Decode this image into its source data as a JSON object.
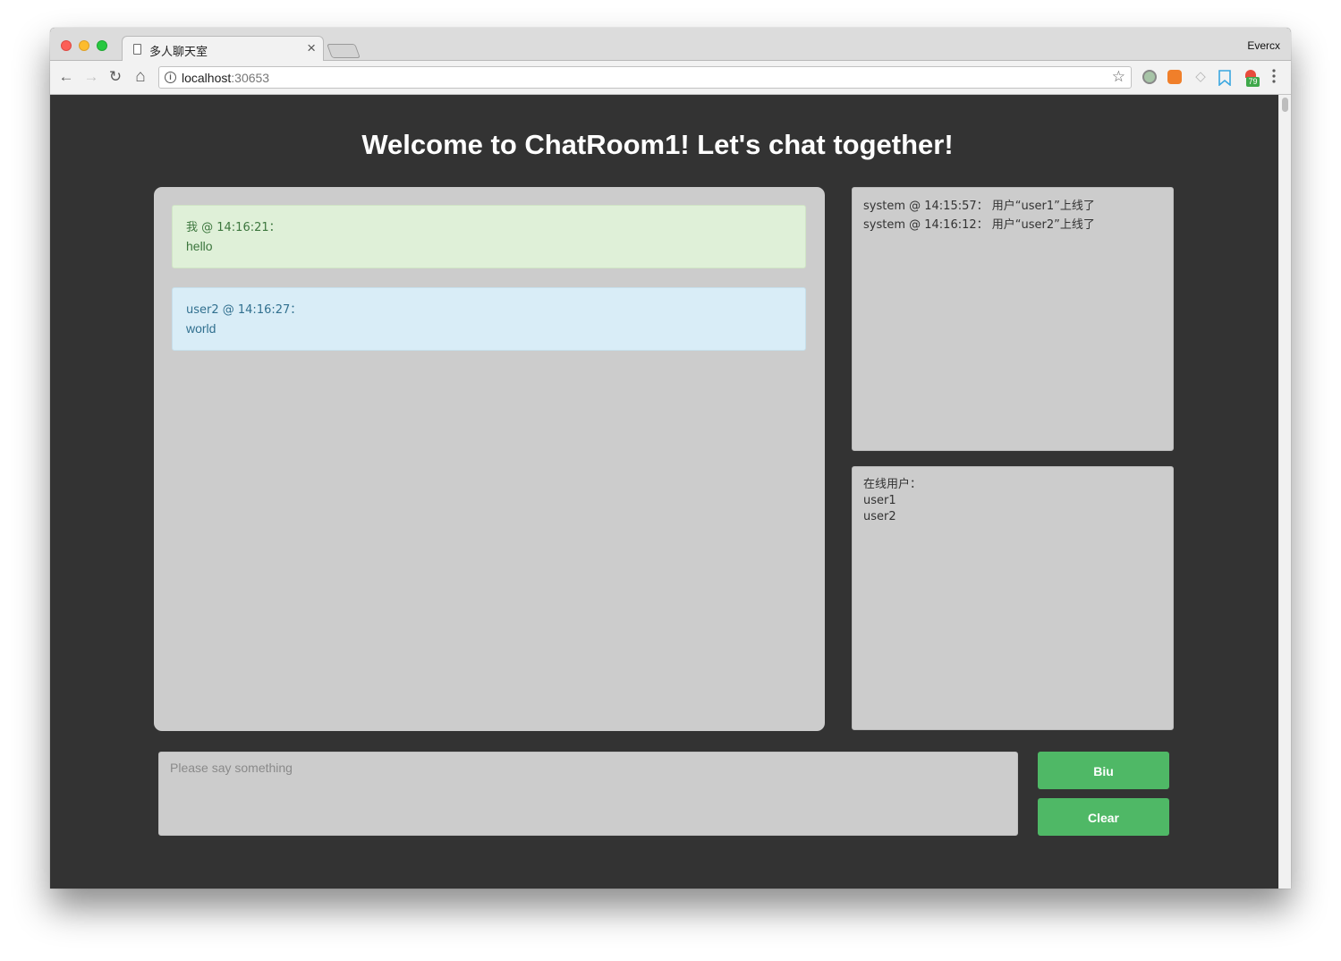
{
  "browser": {
    "tab_title": "多人聊天室",
    "tab_close": "×",
    "profile_name": "Evercx",
    "url_host": "localhost",
    "url_port": ":30653",
    "extension_badge": "79",
    "icons": {
      "back": "←",
      "forward": "→",
      "reload": "↻",
      "home": "⌂",
      "info": "i",
      "star": "☆",
      "shield": "◇",
      "bookmark": "⌑",
      "menu": "⋮"
    }
  },
  "page": {
    "title": "Welcome to ChatRoom1! Let's chat together!"
  },
  "messages": [
    {
      "meta": "我 @ 14:16:21：",
      "text": "hello",
      "kind": "self",
      "color": "#dff0d8"
    },
    {
      "meta": "user2 @ 14:16:27：",
      "text": "world",
      "kind": "other",
      "color": "#d9edf7"
    }
  ],
  "system_log": [
    "system @ 14:15:57：  用户“user1”上线了",
    "system @ 14:16:12：  用户“user2”上线了"
  ],
  "online_users": {
    "heading": "在线用户：",
    "users": [
      "user1",
      "user2"
    ]
  },
  "composer": {
    "placeholder": "Please say something",
    "value": ""
  },
  "buttons": {
    "send_label": "Biu",
    "clear_label": "Clear",
    "color": "#4fb866"
  },
  "colors": {
    "page_background": "#333333",
    "panel_background": "#cccccc"
  }
}
